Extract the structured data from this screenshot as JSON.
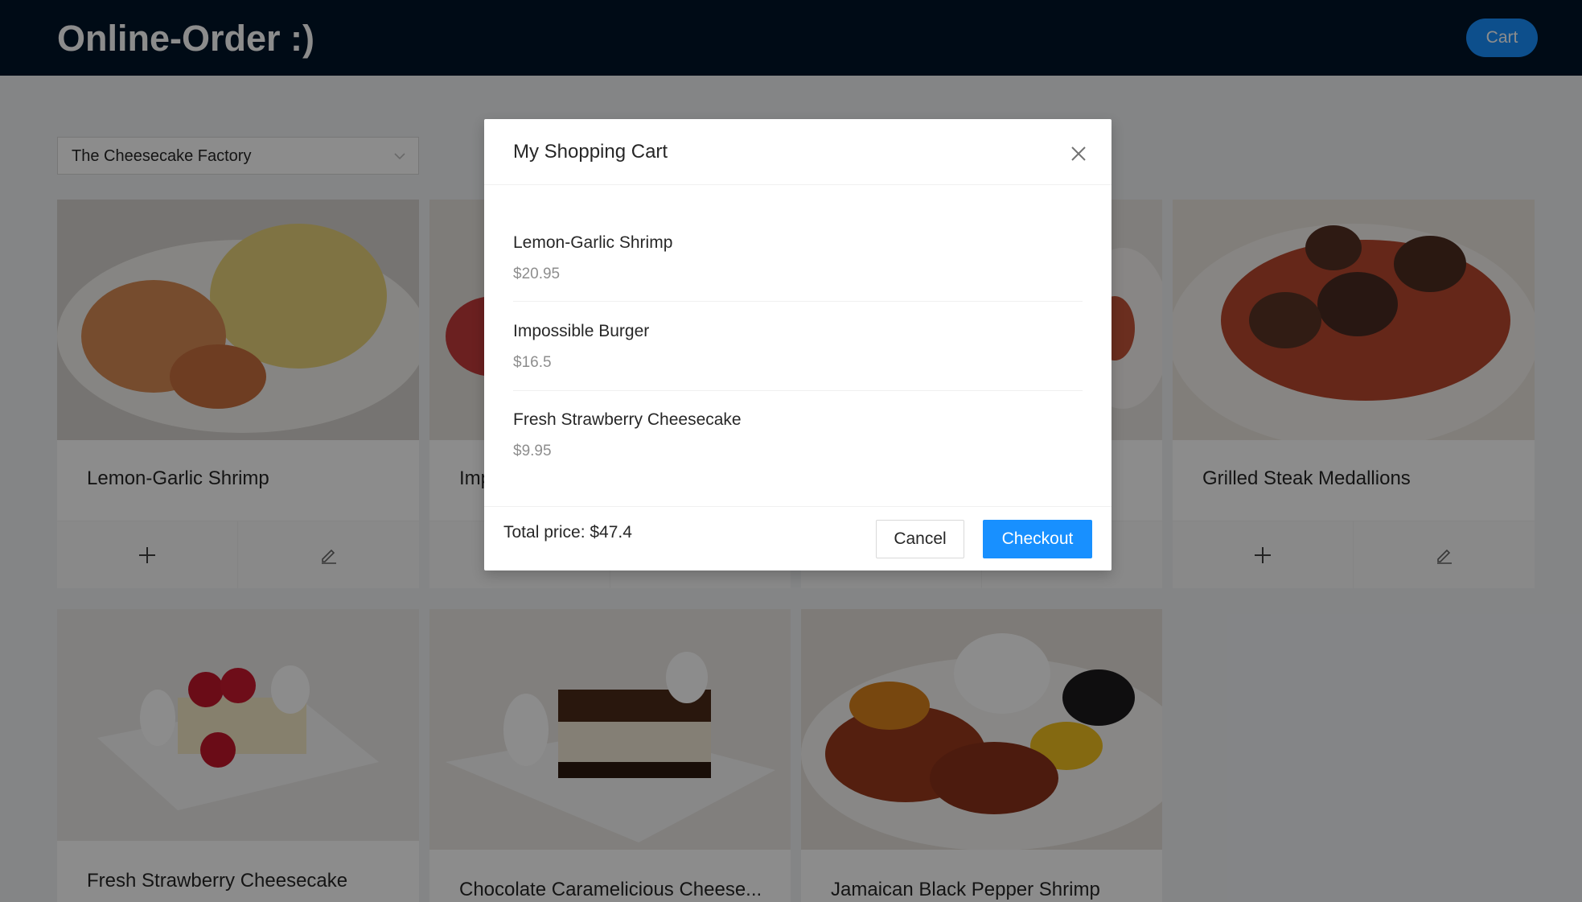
{
  "header": {
    "logo": "Online-Order :)",
    "cart_button": "Cart"
  },
  "restaurant_select": {
    "value": "The Cheesecake Factory"
  },
  "menu": {
    "items": [
      {
        "name": "Lemon-Garlic Shrimp"
      },
      {
        "name": "Impossible Burger"
      },
      {
        "name": ""
      },
      {
        "name": "Grilled Steak Medallions"
      },
      {
        "name": "Fresh Strawberry Cheesecake"
      },
      {
        "name": "Chocolate Caramelicious Cheese..."
      },
      {
        "name": "Jamaican Black Pepper Shrimp"
      }
    ]
  },
  "modal": {
    "title": "My Shopping Cart",
    "items": [
      {
        "name": "Lemon-Garlic Shrimp",
        "price": "$20.95"
      },
      {
        "name": "Impossible Burger",
        "price": "$16.5"
      },
      {
        "name": "Fresh Strawberry Cheesecake",
        "price": "$9.95"
      }
    ],
    "total": "Total price: $47.4",
    "cancel_label": "Cancel",
    "checkout_label": "Checkout"
  },
  "colors": {
    "header_bg": "#001529",
    "primary": "#1890ff",
    "overlay": "rgba(0,0,0,0.45)"
  }
}
